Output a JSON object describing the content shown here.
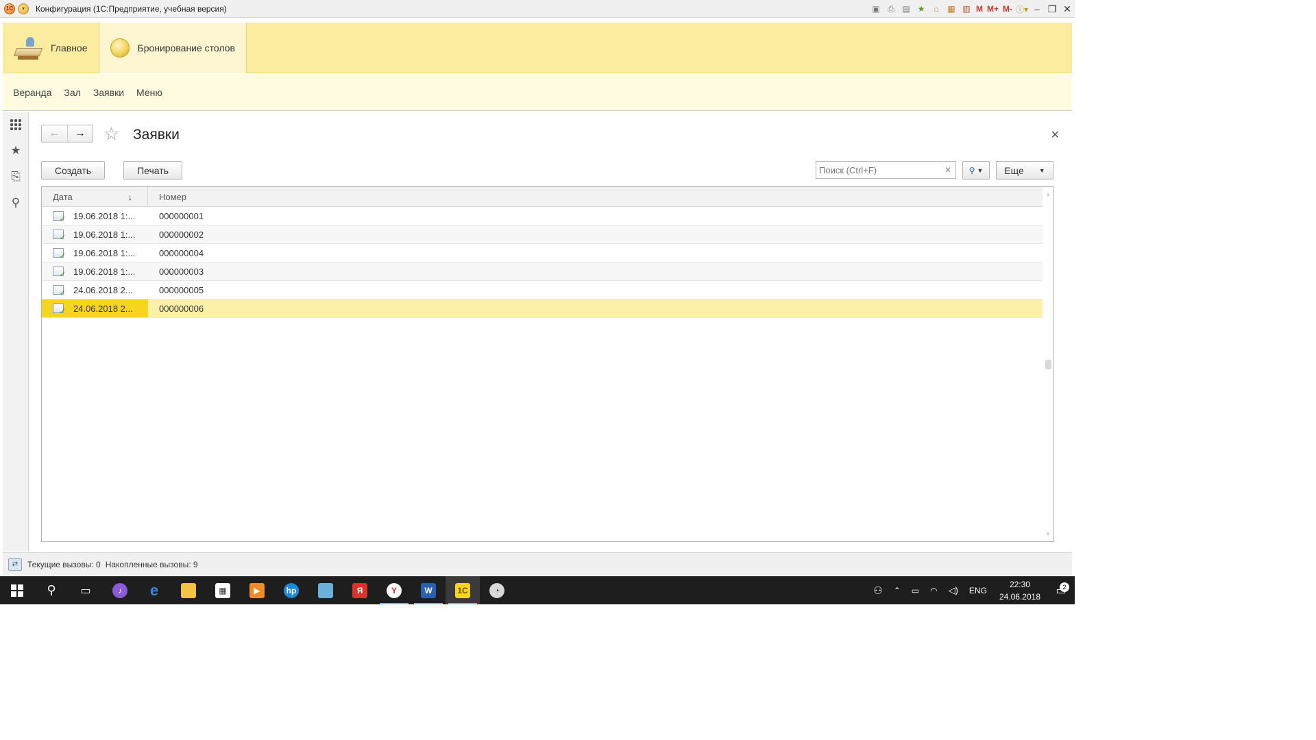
{
  "window": {
    "title": "Конфигурация (1С:Предприятие, учебная версия)",
    "tools": [
      "save-icon",
      "print-icon",
      "preview-icon",
      "favorites-icon",
      "history-icon",
      "calculator-icon",
      "calendar-icon"
    ],
    "memory_labels": [
      "M",
      "M+",
      "M-"
    ]
  },
  "sections": [
    {
      "label": "Главное",
      "icon": "desk-icon"
    },
    {
      "label": "Бронирование столов",
      "icon": "coin-icon"
    }
  ],
  "subsections": [
    "Веранда",
    "Зал",
    "Заявки",
    "Меню"
  ],
  "form": {
    "title": "Заявки",
    "create_label": "Создать",
    "print_label": "Печать",
    "search_placeholder": "Поиск (Ctrl+F)",
    "more_label": "Еще"
  },
  "table": {
    "columns": [
      "Дата",
      "Номер"
    ],
    "sort_indicator": "↓",
    "rows": [
      {
        "date": "19.06.2018 1:...",
        "number": "000000001"
      },
      {
        "date": "19.06.2018 1:...",
        "number": "000000002"
      },
      {
        "date": "19.06.2018 1:...",
        "number": "000000004"
      },
      {
        "date": "19.06.2018 1:...",
        "number": "000000003"
      },
      {
        "date": "24.06.2018 2...",
        "number": "000000005"
      },
      {
        "date": "24.06.2018 2...",
        "number": "000000006"
      }
    ],
    "selected_row": 5
  },
  "status": {
    "current_calls": "Текущие вызовы: 0",
    "accumulated_calls": "Накопленные вызовы: 9"
  },
  "taskbar": {
    "lang": "ENG",
    "time": "22:30",
    "date": "24.06.2018",
    "notifications": "2"
  },
  "colors": {
    "section_bg": "#fbec9f",
    "subsection_bg": "#fefbe0",
    "selected_row": "#fdf0a8",
    "selected_cell": "#f6d51e"
  }
}
